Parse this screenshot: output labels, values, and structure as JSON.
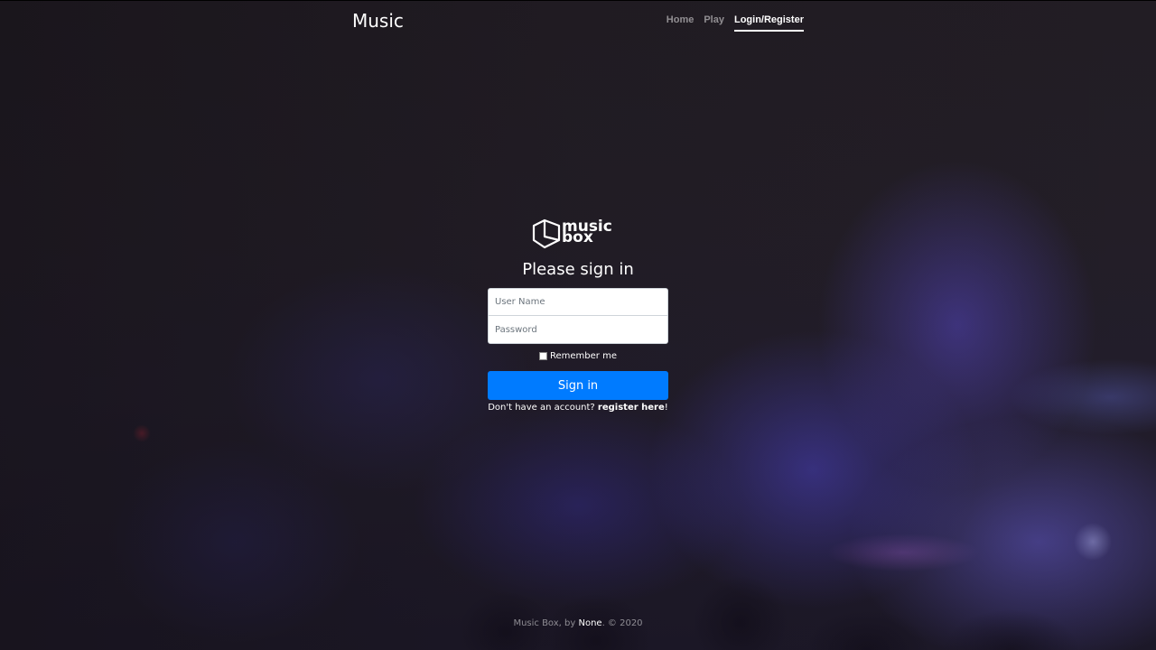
{
  "header": {
    "brand": "Music",
    "nav": [
      {
        "label": "Home"
      },
      {
        "label": "Play"
      },
      {
        "label": "Login/Register"
      }
    ]
  },
  "form": {
    "logo_text_top": "music",
    "logo_text_bottom": "box",
    "heading": "Please sign in",
    "username_placeholder": "User Name",
    "password_placeholder": "Password",
    "remember_label": "Remember me",
    "submit_label": "Sign in",
    "register_prompt": "Don't have an account?",
    "register_link": "register here",
    "register_suffix": "!"
  },
  "footer": {
    "prefix": "Music Box, by",
    "name": "None",
    "suffix": ". © 2020"
  },
  "colors": {
    "primary": "#007bff",
    "background": "#1f1b22"
  }
}
